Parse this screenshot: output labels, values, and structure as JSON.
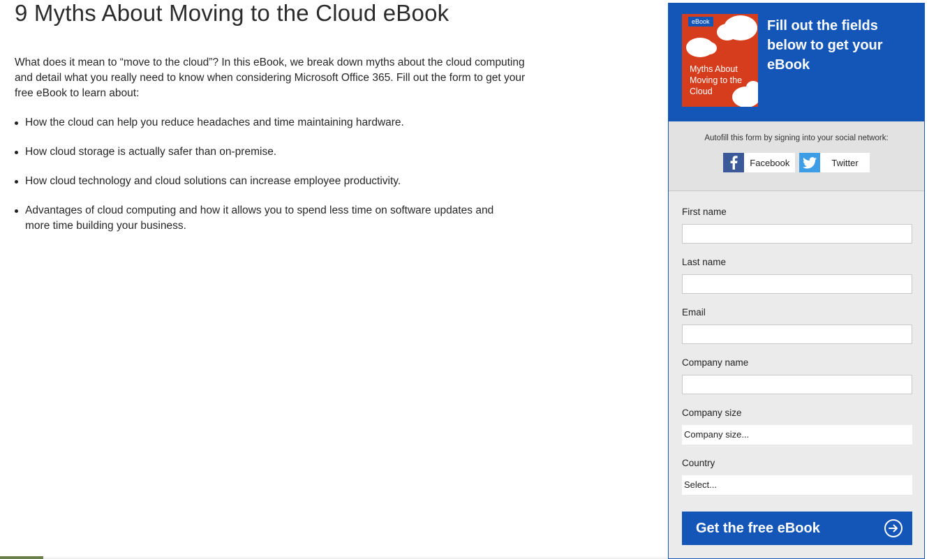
{
  "page": {
    "title": "9 Myths About Moving to the Cloud eBook",
    "intro": "What does it mean to “move to the cloud”? In this eBook, we break down myths about the cloud computing and detail what you really need to know when considering Microsoft Office 365. Fill out the form to get your free eBook to learn about:",
    "bullets": [
      "How the cloud can help you reduce headaches and time maintaining hardware.",
      "How cloud storage is actually safer than on-premise.",
      "How cloud technology and cloud solutions can increase employee productivity.",
      "Advantages of cloud computing and how it allows you to spend less time on software updates and more time building your business."
    ]
  },
  "panel": {
    "cover_badge": "eBook",
    "cover_title": "Myths About Moving to the Cloud",
    "heading": "Fill out the fields below to get your eBook",
    "social_text": "Autofill this form by signing into your social network:",
    "facebook_label": "Facebook",
    "twitter_label": "Twitter",
    "facebook_icon": "facebook-icon",
    "twitter_icon": "twitter-icon",
    "fields": {
      "first_name_label": "First name",
      "last_name_label": "Last name",
      "email_label": "Email",
      "company_name_label": "Company name",
      "company_size_label": "Company size",
      "company_size_value": "Company size...",
      "country_label": "Country",
      "country_value": "Select..."
    },
    "submit_label": "Get the free eBook",
    "submit_icon": "arrow-right-circle-icon"
  },
  "colors": {
    "brand_blue": "#1456b8",
    "cover_orange": "#d63d1c",
    "facebook_blue": "#3b5998",
    "twitter_blue": "#3d9ee7"
  }
}
